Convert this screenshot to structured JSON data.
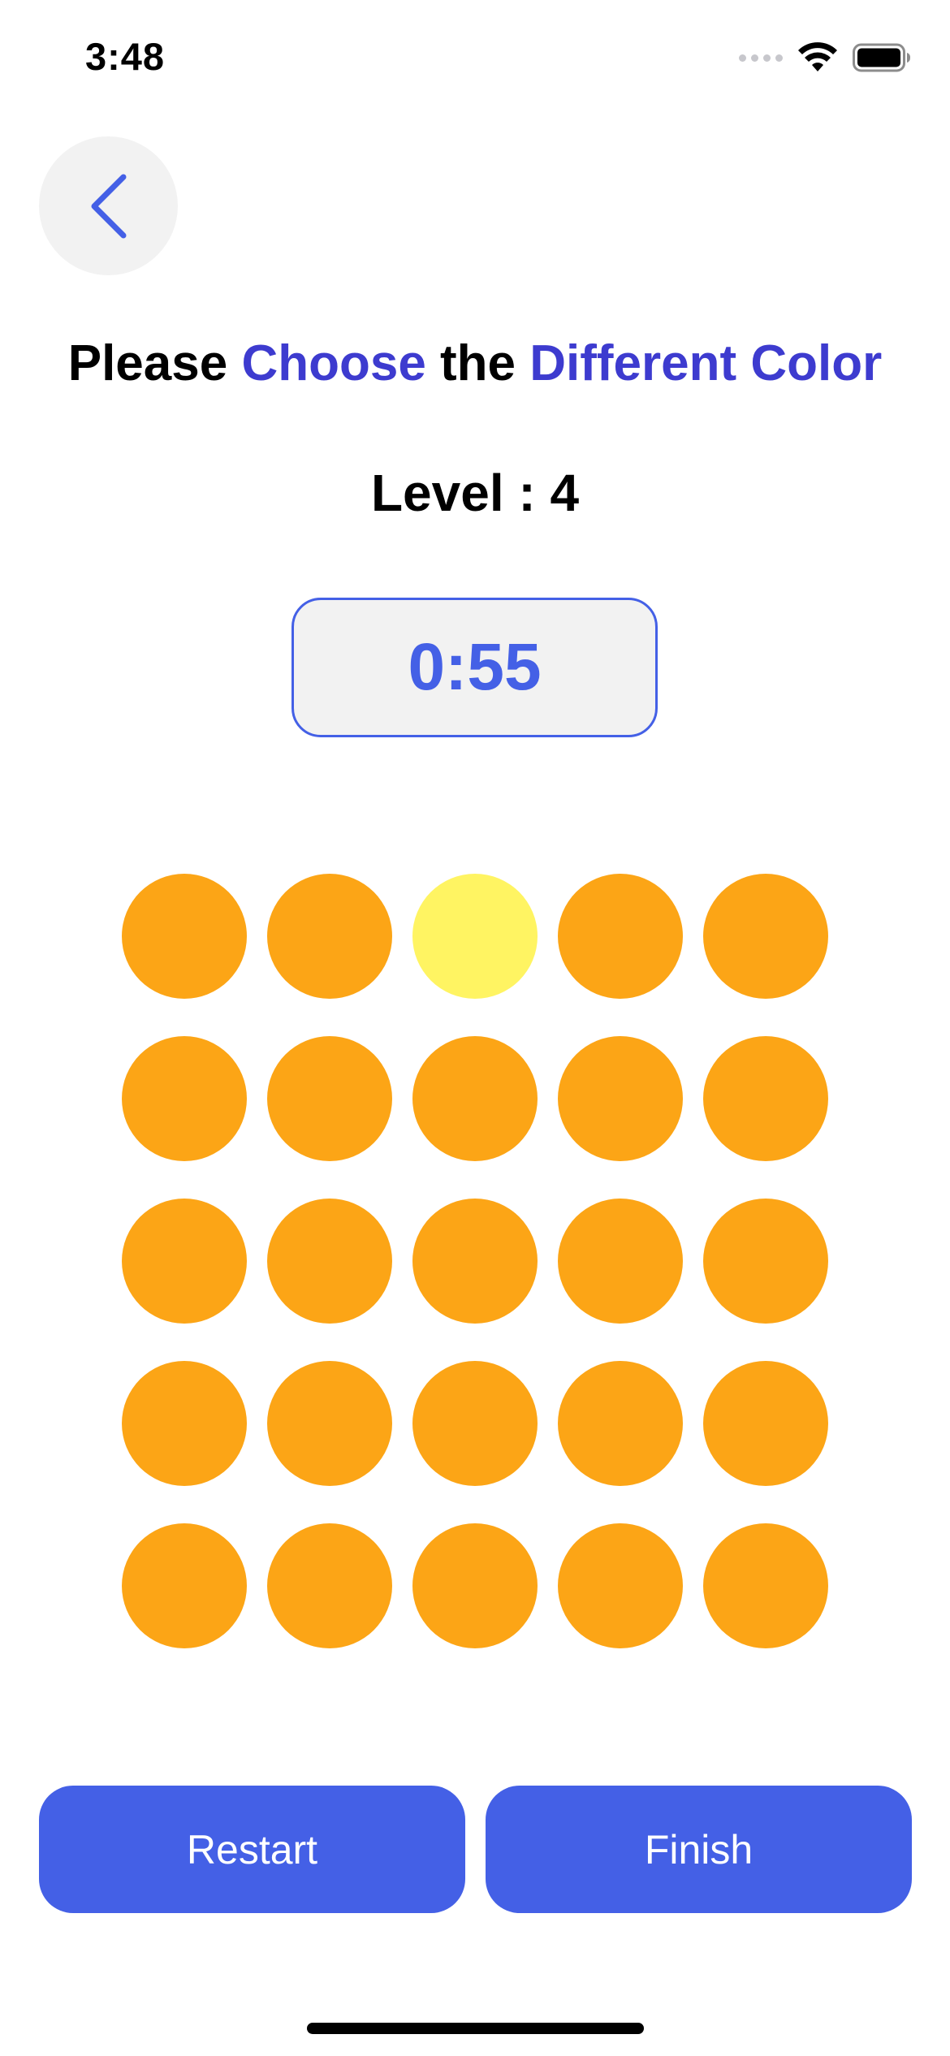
{
  "status_bar": {
    "time": "3:48",
    "icons": [
      "signal-icon",
      "wifi-icon",
      "battery-icon"
    ]
  },
  "nav": {
    "back_icon": "chevron-left-icon"
  },
  "title": {
    "part1": "Please ",
    "part2": "Choose",
    "part3": " the ",
    "part4": "Different Color"
  },
  "level": "Level : 4",
  "timer": "0:55",
  "colors": {
    "accent": "#4460e6",
    "title_accent": "#3d3bcf",
    "base_circle": "#fca516",
    "odd_circle": "#fff462"
  },
  "grid": {
    "columns": 5,
    "rows": 5,
    "odd_index": 2
  },
  "buttons": {
    "restart": "Restart",
    "finish": "Finish"
  }
}
